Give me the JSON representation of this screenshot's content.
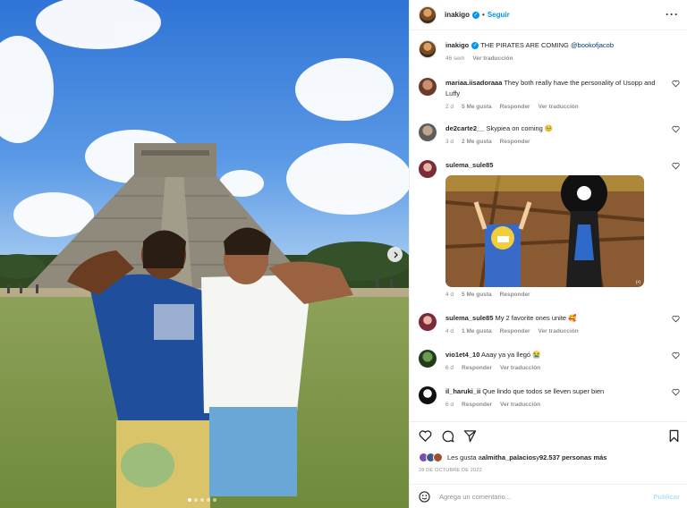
{
  "post": {
    "username": "inakigo",
    "follow_label": "Seguir",
    "separator": "•",
    "more_icon": "more-horizontal-icon",
    "caption_user": "inakigo",
    "caption_text": "THE PIRATES ARE COMING ",
    "caption_mention": "@bookofjacob",
    "caption_age": "46 sem",
    "caption_translate": "Ver traducción",
    "verified_color": "#0095f6"
  },
  "comments": [
    {
      "user": "mariaa.iisadoraaa",
      "text": "They both really have the personality of Usopp and Luffy",
      "age": "2 d",
      "likes": "5 Me gusta",
      "reply": "Responder",
      "translate": "Ver traducción"
    },
    {
      "user": "de2carte2__",
      "text": "Skypiea on coming 🥺",
      "age": "3 d",
      "likes": "2 Me gusta",
      "reply": "Responder"
    },
    {
      "user": "sulema_sule85",
      "text": "",
      "age": "4 d",
      "likes": "5 Me gusta",
      "reply": "Responder",
      "image_icon": "one-piece-manga-image"
    },
    {
      "user": "sulema_sule85",
      "text": "My 2 favorite ones unite 🥰",
      "age": "4 d",
      "likes": "1 Me gusta",
      "reply": "Responder",
      "translate": "Ver traducción"
    },
    {
      "user": "vio1et4_10",
      "text": "Aaay ya ya llegó 😭",
      "age": "6 d",
      "reply": "Responder",
      "translate": "Ver traducción"
    },
    {
      "user": "il_haruki_ii",
      "text": "Que lindo que todos se lleven super bien",
      "age": "6 d",
      "reply": "Responder",
      "translate": "Ver traducción"
    }
  ],
  "actions": {
    "likes_prefix": "Les gusta a ",
    "likes_user": "almitha_palacios",
    "likes_middle": " y ",
    "likes_count": "92.537 personas más",
    "date": "28 DE OCTUBRE DE 2022",
    "comment_placeholder": "Agrega un comentario...",
    "publish_label": "Publicar"
  },
  "carousel": {
    "current": 1,
    "total": 5
  },
  "colors": {
    "link": "#00376b",
    "accent": "#0095f6",
    "muted": "#8e8e8e",
    "publish_disabled": "#b2dffc"
  }
}
